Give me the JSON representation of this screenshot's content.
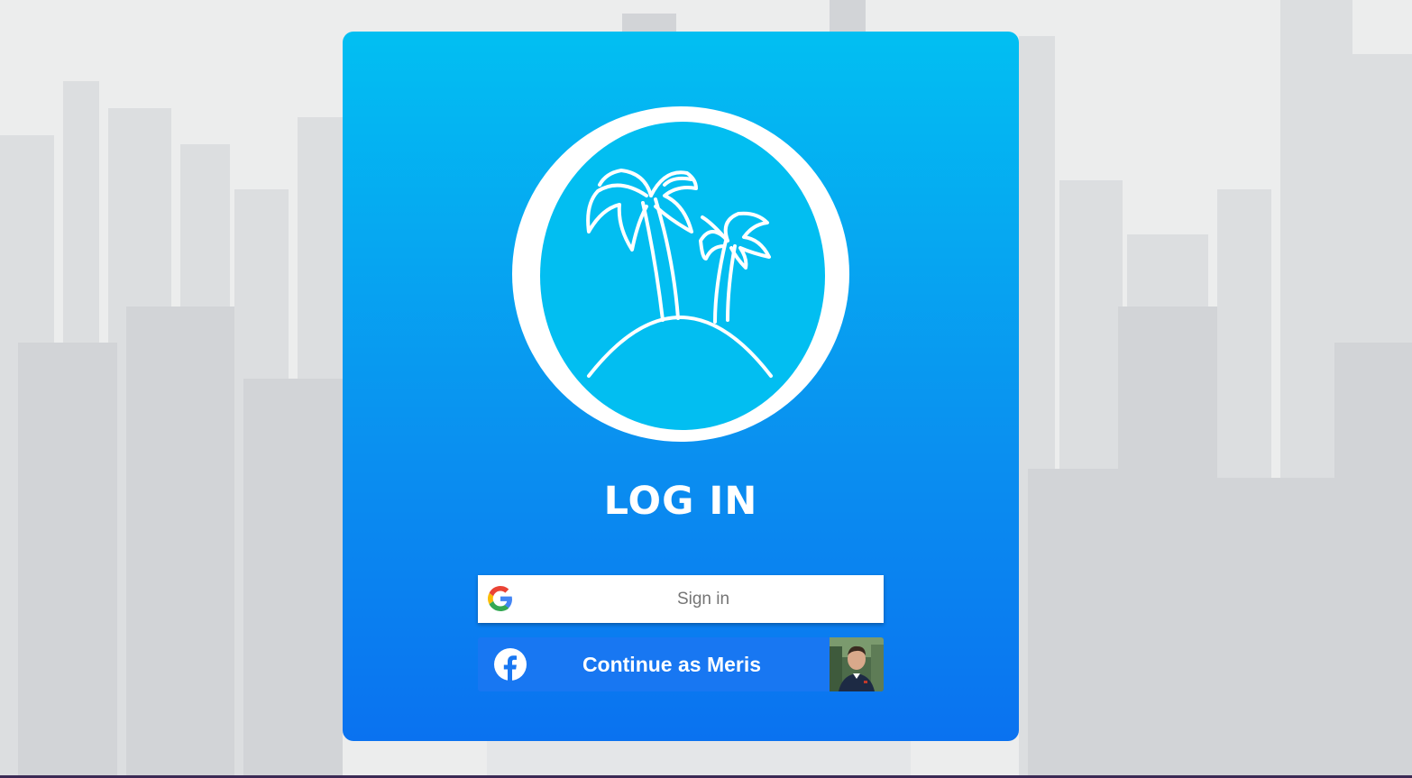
{
  "login": {
    "title": "LOG IN",
    "google_label": "Sign in",
    "facebook_label": "Continue as Meris"
  },
  "icons": {
    "logo": "palm-island-logo",
    "google": "google-g-icon",
    "facebook": "facebook-f-icon",
    "avatar": "profile-avatar"
  },
  "colors": {
    "card_top": "#02bff2",
    "card_bottom": "#0a72f0",
    "facebook_blue": "#1877f2",
    "google_text": "#757575"
  }
}
